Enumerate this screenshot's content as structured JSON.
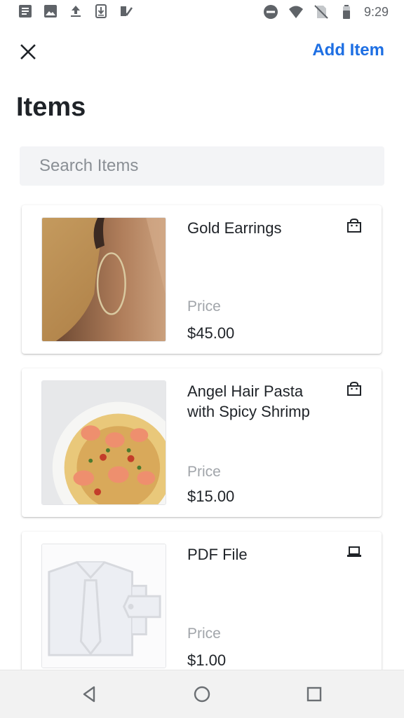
{
  "status_bar": {
    "time": "9:29",
    "left_icons": [
      "document-icon",
      "image-icon",
      "upload-icon",
      "download-icon",
      "task-check-icon"
    ],
    "right_icons": [
      "do-not-disturb-icon",
      "wifi-icon",
      "no-sim-icon",
      "battery-icon"
    ]
  },
  "header": {
    "add_item_label": "Add Item",
    "title": "Items"
  },
  "search": {
    "placeholder": "Search Items"
  },
  "items": [
    {
      "name": "Gold Earrings",
      "price_label": "Price",
      "price": "$45.00",
      "type_icon": "shopping-bag-icon"
    },
    {
      "name": "Angel Hair Pasta with Spicy Shrimp",
      "price_label": "Price",
      "price": "$15.00",
      "type_icon": "shopping-bag-icon"
    },
    {
      "name": "PDF File",
      "price_label": "Price",
      "price": "$1.00",
      "type_icon": "laptop-icon"
    }
  ],
  "colors": {
    "accent": "#1e6fe3",
    "text": "#1f2328",
    "muted": "#a1a5aa",
    "search_bg": "#f3f4f6"
  }
}
